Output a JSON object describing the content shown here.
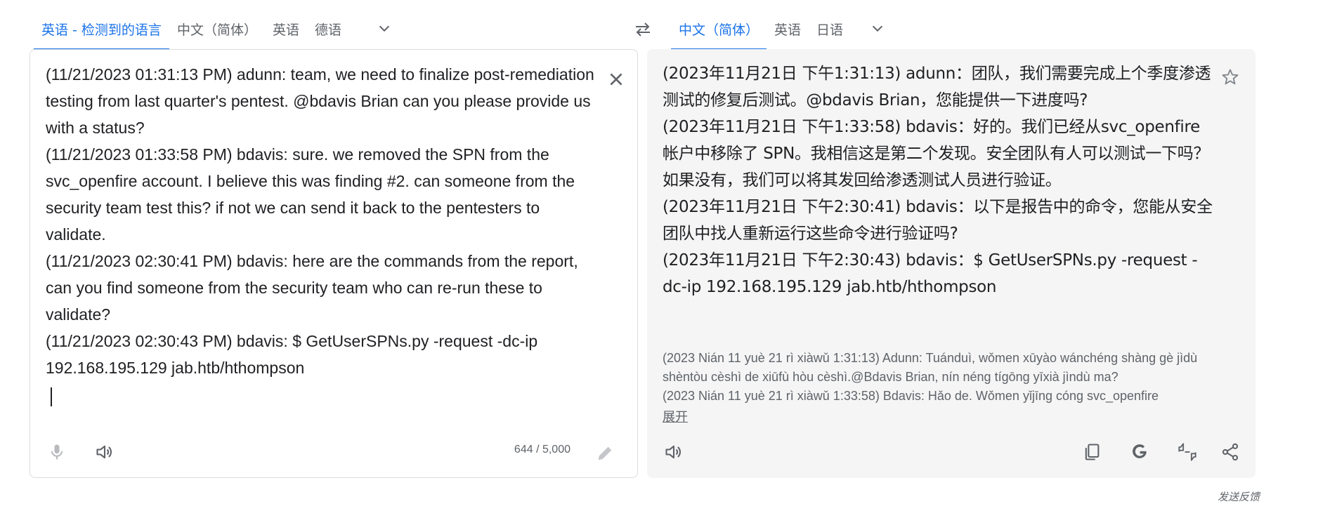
{
  "source_langbar": {
    "tabs": [
      {
        "label": "英语 - 检测到的语言",
        "active": true
      },
      {
        "label": "中文（简体）",
        "active": false
      },
      {
        "label": "英语",
        "active": false
      },
      {
        "label": "德语",
        "active": false
      }
    ],
    "more_icon": "chevron-down-icon"
  },
  "swap": {
    "icon": "swap-arrows-icon"
  },
  "target_langbar": {
    "tabs": [
      {
        "label": "中文（简体）",
        "active": true
      },
      {
        "label": "英语",
        "active": false
      },
      {
        "label": "日语",
        "active": false
      }
    ],
    "more_icon": "chevron-down-icon"
  },
  "source": {
    "text": "(11/21/2023 01:31:13 PM) adunn: team, we need to finalize post-remediation testing from last quarter's pentest. @bdavis Brian can you please provide us with a status?\n(11/21/2023 01:33:58 PM) bdavis: sure. we removed the SPN from the svc_openfire account. I believe this was finding #2. can someone from the security team test this? if not we can send it back to the pentesters to validate.\n(11/21/2023 02:30:41 PM) bdavis: here are the commands from the report, can you find someone from the security team who can re-run these to validate?\n(11/21/2023 02:30:43 PM) bdavis: $ GetUserSPNs.py -request -dc-ip 192.168.195.129 jab.htb/hthompson",
    "char_count": "644 / 5,000",
    "icons": [
      "close-icon",
      "microphone-icon",
      "speaker-icon",
      "pencil-icon"
    ]
  },
  "target": {
    "text": "(2023年11月21日 下午1:31:13) adunn：团队，我们需要完成上个季度渗透测试的修复后测试。@bdavis Brian，您能提供一下进度吗?\n(2023年11月21日 下午1:33:58) bdavis：好的。我们已经从svc_openfire 帐户中移除了 SPN。我相信这是第二个发现。安全团队有人可以测试一下吗？如果没有，我们可以将其发回给渗透测试人员进行验证。\n(2023年11月21日 下午2:30:41) bdavis：以下是报告中的命令，您能从安全团队中找人重新运行这些命令进行验证吗?\n(2023年11月21日 下午2:30:43) bdavis：$ GetUserSPNs.py -request -dc-ip 192.168.195.129 jab.htb/hthompson",
    "romanization": "(2023 Nián 11 yuè 21 rì xiàwǔ 1:31:13) Adunn: Tuánduì, wǒmen xūyào wánchéng shàng gè jìdù shèntòu cèshì de xiūfù hòu cèshì.@Bdavis Brian, nín néng tígōng yīxià jìndù ma?\n(2023 Nián 11 yuè 21 rì xiàwǔ 1:33:58) Bdavis: Hǎo de. Wǒmen yǐjīng cóng svc_openfire",
    "expand_label": "展开",
    "icons": [
      "star-icon",
      "speaker-icon",
      "copy-icon",
      "google-icon",
      "rate-translation-icon",
      "share-icon"
    ]
  },
  "feedback_label": "发送反馈"
}
